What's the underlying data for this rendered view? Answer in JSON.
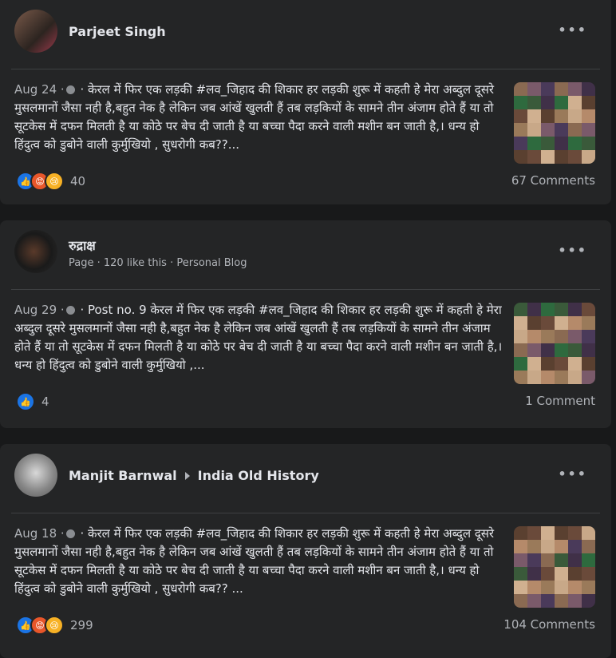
{
  "posts": [
    {
      "author": "Parjeet Singh",
      "date": "Aug 24 ·",
      "text": " · केरल में फिर एक लड़की #लव_जिहाद की शिकार हर लड़की शुरू में कहती हे मेरा अब्दुल दूसरे मुसलमानों जैसा नही है,बहुत नेक है लेकिन जब आंखें खुलती हैं तब लड़कियों के सामने तीन अंजाम होते हैं या तो सूटकेस में दफन मिलती है या कोठे पर बेच दी जाती है या बच्चा पैदा करने वाली मशीन बन जाती है,। धन्य हो हिंदुत्व को डुबोने वाली कुर्मुखियो , सुधरोगी कब??...",
      "reaction_count": "40",
      "comments": "67 Comments",
      "reactions": [
        "like-icon",
        "angry-icon",
        "sad-icon"
      ]
    },
    {
      "author": "रुद्राक्ष",
      "meta": "Page · 120 like this · Personal Blog",
      "date": "Aug 29 ·",
      "text": " · Post no. 9 केरल में फिर एक लड़की #लव_जिहाद की शिकार हर लड़की शुरू में कहती हे मेरा अब्दुल दूसरे मुसलमानों जैसा नही है,बहुत नेक है लेकिन जब आंखें खुलती हैं तब लड़कियों के सामने तीन अंजाम होते हैं या तो सूटकेस में दफन मिलती है या कोठे पर बेच दी जाती है या बच्चा पैदा करने वाली मशीन बन जाती है,। धन्य हो हिंदुत्व को डुबोने वाली कुर्मुखियो ,...",
      "reaction_count": "4",
      "comments": "1 Comment",
      "reactions": [
        "like-icon"
      ]
    },
    {
      "author": "Manjit Barnwal",
      "group": "India Old History",
      "date": "Aug 18 ·",
      "text": " · केरल में फिर एक लड़की #लव_जिहाद की शिकार हर लड़की शुरू में कहती हे मेरा अब्दुल दूसरे मुसलमानों जैसा नही है,बहुत नेक है लेकिन जब आंखें खुलती हैं तब लड़कियों के सामने तीन अंजाम होते हैं या तो सूटकेस में दफन मिलती है या कोठे पर बेच दी जाती है या बच्चा पैदा करने वाली मशीन बन जाती है,। धन्य हो हिंदुत्व को डुबोने वाली कुर्मुखियो , सुधरोगी कब?? ...",
      "reaction_count": "299",
      "comments": "104 Comments",
      "reactions": [
        "like-icon",
        "angry-icon",
        "sad-icon"
      ]
    }
  ],
  "more_label": "•••",
  "colors": {
    "background": "#18191a",
    "card": "#242526",
    "like": "#1b74e4"
  }
}
